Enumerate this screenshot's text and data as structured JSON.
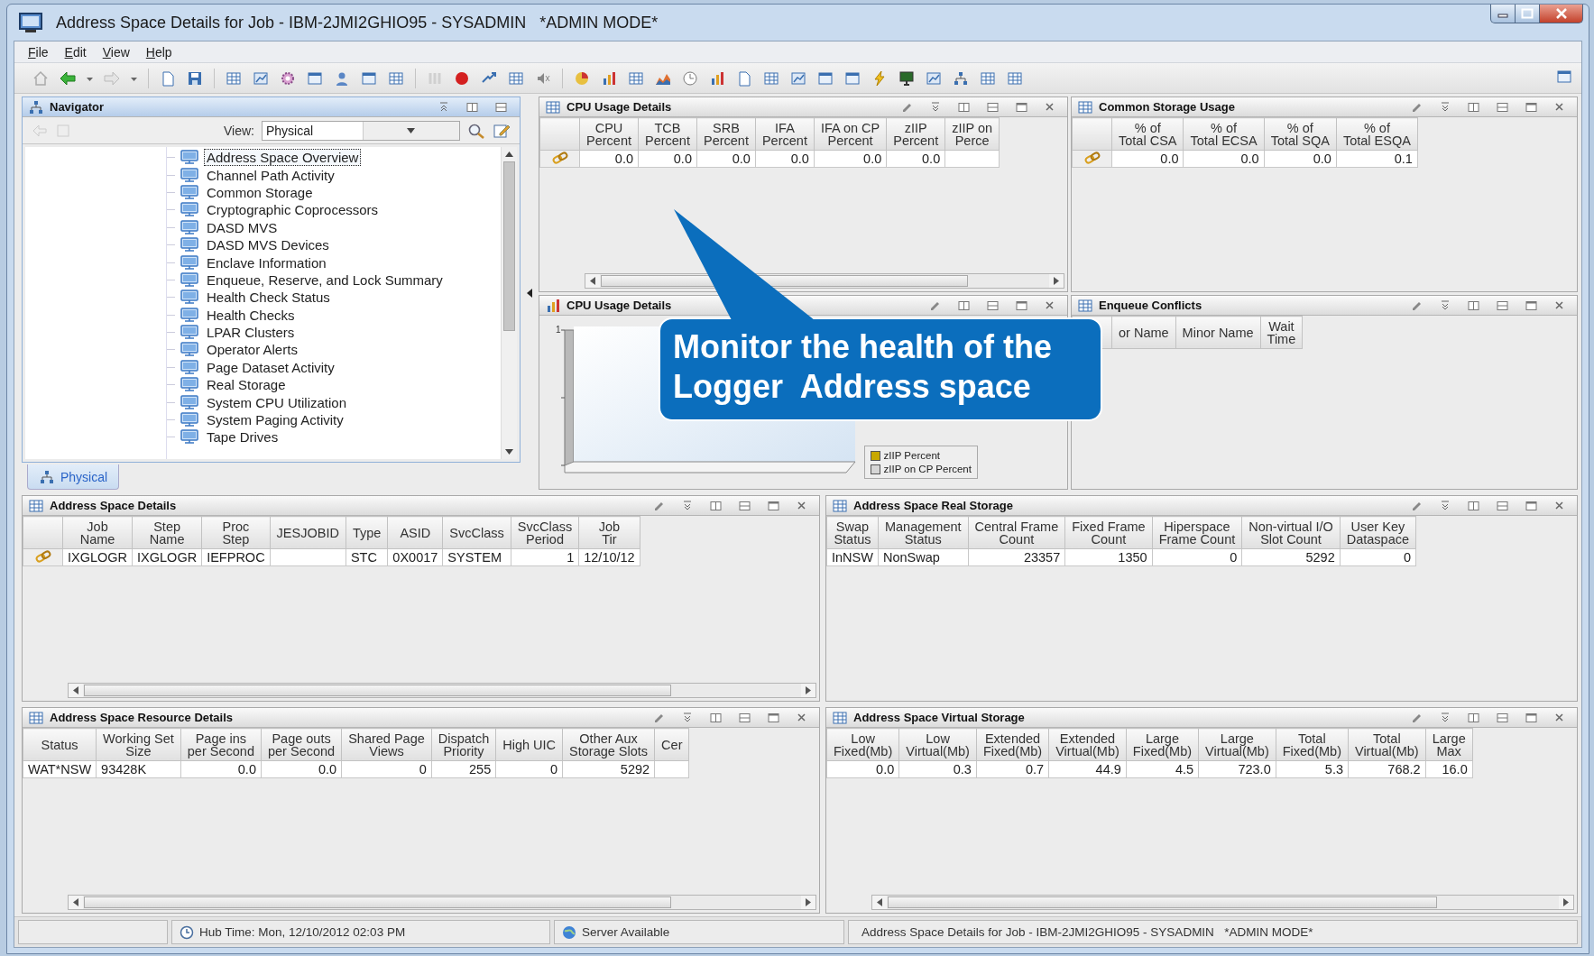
{
  "window": {
    "title": "Address Space Details for Job - IBM-2JMI2GHIO95 - SYSADMIN   *ADMIN MODE*"
  },
  "menu": [
    "File",
    "Edit",
    "View",
    "Help"
  ],
  "navigator": {
    "title": "Navigator",
    "view_label": "View:",
    "view_value": "Physical",
    "items": [
      {
        "label": "Address Space Overview",
        "selected": true
      },
      {
        "label": "Channel Path Activity",
        "selected": false
      },
      {
        "label": "Common Storage",
        "selected": false
      },
      {
        "label": "Cryptographic Coprocessors",
        "selected": false
      },
      {
        "label": "DASD MVS",
        "selected": false
      },
      {
        "label": "DASD MVS Devices",
        "selected": false
      },
      {
        "label": "Enclave Information",
        "selected": false
      },
      {
        "label": "Enqueue, Reserve, and Lock Summary",
        "selected": false
      },
      {
        "label": "Health Check Status",
        "selected": false
      },
      {
        "label": "Health Checks",
        "selected": false
      },
      {
        "label": "LPAR Clusters",
        "selected": false
      },
      {
        "label": "Operator Alerts",
        "selected": false
      },
      {
        "label": "Page Dataset Activity",
        "selected": false
      },
      {
        "label": "Real Storage",
        "selected": false
      },
      {
        "label": "System CPU Utilization",
        "selected": false
      },
      {
        "label": "System Paging Activity",
        "selected": false
      },
      {
        "label": "Tape Drives",
        "selected": false
      }
    ],
    "tab": {
      "label": "Physical",
      "selected": true
    }
  },
  "panels": [
    {
      "kind": "table",
      "title": "CPU Usage Details",
      "row_header": true,
      "h_scroll": true,
      "columns": [
        "CPU\nPercent",
        "TCB\nPercent",
        "SRB\nPercent",
        "IFA\nPercent",
        "IFA on CP\nPercent",
        "zIIP\nPercent",
        "zIIP on\nPerce"
      ],
      "rows": [
        [
          "0.0",
          "0.0",
          "0.0",
          "0.0",
          "0.0",
          "0.0",
          null
        ]
      ]
    },
    {
      "kind": "table",
      "title": "Common Storage Usage",
      "row_header": true,
      "h_scroll": false,
      "columns": [
        "% of\nTotal CSA",
        "% of\nTotal ECSA",
        "% of\nTotal SQA",
        "% of\nTotal ESQA"
      ],
      "rows": [
        [
          "0.0",
          "0.0",
          "0.0",
          "0.1"
        ]
      ]
    },
    {
      "kind": "chart",
      "title": "CPU Usage Details",
      "y_tick": "1",
      "legend": [
        {
          "label": "zIIP Percent",
          "color": "#c8a800"
        },
        {
          "label": "zIIP on CP Percent",
          "color": "#d6d6d6"
        }
      ]
    },
    {
      "kind": "table",
      "title": "Enqueue Conflicts",
      "row_header": true,
      "h_scroll": false,
      "columns": [
        "or Name",
        "Minor Name",
        "Wait\nTime"
      ]
    },
    {
      "kind": "table",
      "title": "Address Space Details",
      "row_header": true,
      "h_scroll": true,
      "columns": [
        "Job\nName",
        "Step\nName",
        "Proc\nStep",
        "JESJOBID",
        "Type",
        "ASID",
        "SvcClass",
        "SvcClass\nPeriod",
        "Job\nTir"
      ],
      "rows": [
        [
          "IXGLOGR",
          "IXGLOGR",
          "IEFPROC",
          null,
          "STC",
          "0X0017",
          "SYSTEM",
          "1",
          "12/10/12"
        ]
      ]
    },
    {
      "kind": "table",
      "title": "Address Space Real Storage",
      "row_header": false,
      "h_scroll": false,
      "columns": [
        "Swap\nStatus",
        "Management\nStatus",
        "Central Frame\nCount",
        "Fixed Frame\nCount",
        "Hiperspace\nFrame Count",
        "Non-virtual I/O\nSlot Count",
        "User Key\nDataspace"
      ],
      "rows": [
        [
          "InNSW",
          "NonSwap",
          "23357",
          "1350",
          "0",
          "5292",
          "0"
        ]
      ]
    },
    {
      "kind": "table",
      "title": "Address Space Resource Details",
      "row_header": false,
      "h_scroll": true,
      "columns": [
        "Status",
        "Working Set\nSize",
        "Page ins\nper Second",
        "Page outs\nper Second",
        "Shared Page\nViews",
        "Dispatch\nPriority",
        "High UIC",
        "Other Aux\nStorage Slots",
        "Cer"
      ],
      "rows": [
        [
          "WAT*NSW",
          "93428K",
          "0.0",
          "0.0",
          "0",
          "255",
          "0",
          "5292",
          null
        ]
      ]
    },
    {
      "kind": "table",
      "title": "Address Space Virtual Storage",
      "row_header": false,
      "h_scroll": true,
      "columns": [
        "Low\nFixed(Mb)",
        "Low\nVirtual(Mb)",
        "Extended\nFixed(Mb)",
        "Extended\nVirtual(Mb)",
        "Large\nFixed(Mb)",
        "Large\nVirtual(Mb)",
        "Total\nFixed(Mb)",
        "Total\nVirtual(Mb)",
        "Large\nMax"
      ],
      "rows": [
        [
          "0.0",
          "0.3",
          "0.7",
          "44.9",
          "4.5",
          "723.0",
          "5.3",
          "768.2",
          "16.0"
        ]
      ]
    }
  ],
  "status_bar": [
    {
      "kind": "blank"
    },
    {
      "kind": "clock",
      "text": "Hub Time: Mon, 12/10/2012 02:03 PM"
    },
    {
      "kind": "server",
      "text": "Server Available"
    },
    {
      "kind": "text",
      "text": "Address Space Details for Job - IBM-2JMI2GHIO95 - SYSADMIN   *ADMIN MODE*"
    }
  ],
  "callout": {
    "lines": [
      "Monitor the health of the",
      "Logger  Address space"
    ]
  }
}
